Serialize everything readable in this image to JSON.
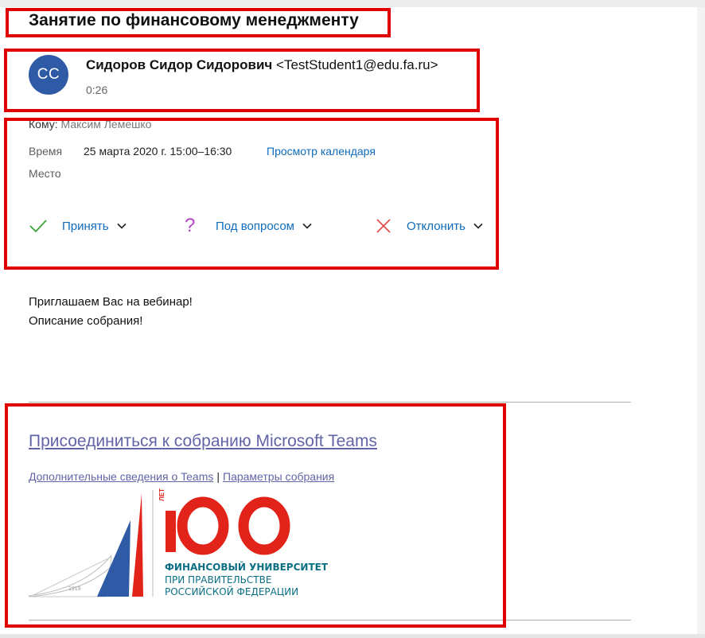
{
  "email": {
    "subject": "Занятие по финансовому менеджменту",
    "avatar_initials": "СС",
    "sender_name": "Сидоров Сидор Сидорович",
    "sender_email": "<TestStudent1@edu.fa.ru>",
    "sent_time": "0:26"
  },
  "meeting": {
    "to_label": "Кому:",
    "to_value": "Максим Лемешко",
    "time_label": "Время",
    "time_value": "25 марта 2020 г. 15:00–16:30",
    "calendar_link": "Просмотр календаря",
    "place_label": "Место",
    "responses": [
      {
        "label": "Принять",
        "icon": "check-icon",
        "color": "#3aa53a"
      },
      {
        "label": "Под вопросом",
        "icon": "question-icon",
        "color": "#b146c2"
      },
      {
        "label": "Отклонить",
        "icon": "close-icon",
        "color": "#e04a4a"
      }
    ]
  },
  "body": {
    "line1": "Приглашаем Вас на вебинар!",
    "line2": "Описание собрания!"
  },
  "teams": {
    "join_link": "Присоединиться к собранию Microsoft Teams",
    "more_info_link": "Дополнительные сведения о Teams",
    "separator": "|",
    "options_link": "Параметры собрания"
  },
  "logo": {
    "years_label": "ЛЕТ",
    "number": "100",
    "year": "1919",
    "line1": "ФИНАНСОВЫЙ УНИВЕРСИТЕТ",
    "line2": "ПРИ ПРАВИТЕЛЬСТВЕ",
    "line3": "РОССИЙСКОЙ ФЕДЕРАЦИИ"
  },
  "colors": {
    "annotation_box": "#e00000",
    "avatar": "#2f5aa5",
    "link": "#0f6cbd",
    "teams_link": "#6264a7",
    "logo_red": "#e2231a",
    "logo_teal": "#0b6f84",
    "logo_blue": "#2f5aa5"
  }
}
